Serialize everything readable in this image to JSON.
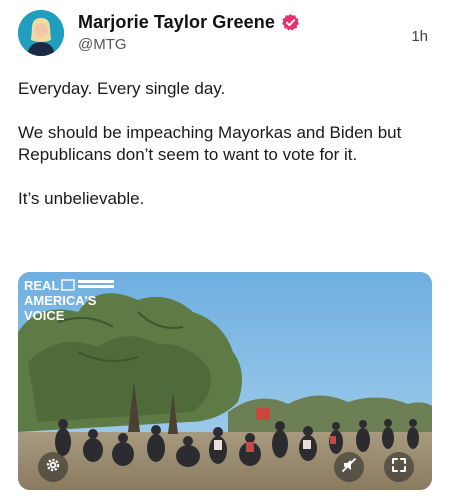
{
  "post": {
    "author": {
      "display_name": "Marjorie Taylor Greene",
      "handle": "@MTG",
      "verified": true
    },
    "timestamp": "1h",
    "paragraphs": [
      "Everyday. Every single day.",
      "We should be impeaching Mayorkas and Biden but Republicans don’t seem to want to vote for it.",
      "It’s unbelievable."
    ],
    "media": {
      "watermark": "REAL AMERICA'S VOICE",
      "watermark_lines": [
        "REAL",
        "AMERICA'S",
        "VOICE"
      ],
      "controls": [
        "settings-icon",
        "mute-icon",
        "fullscreen-icon"
      ]
    }
  },
  "colors": {
    "verified_badge": "#e6316e",
    "handle": "#555555",
    "sky": "#7fb7e2"
  }
}
